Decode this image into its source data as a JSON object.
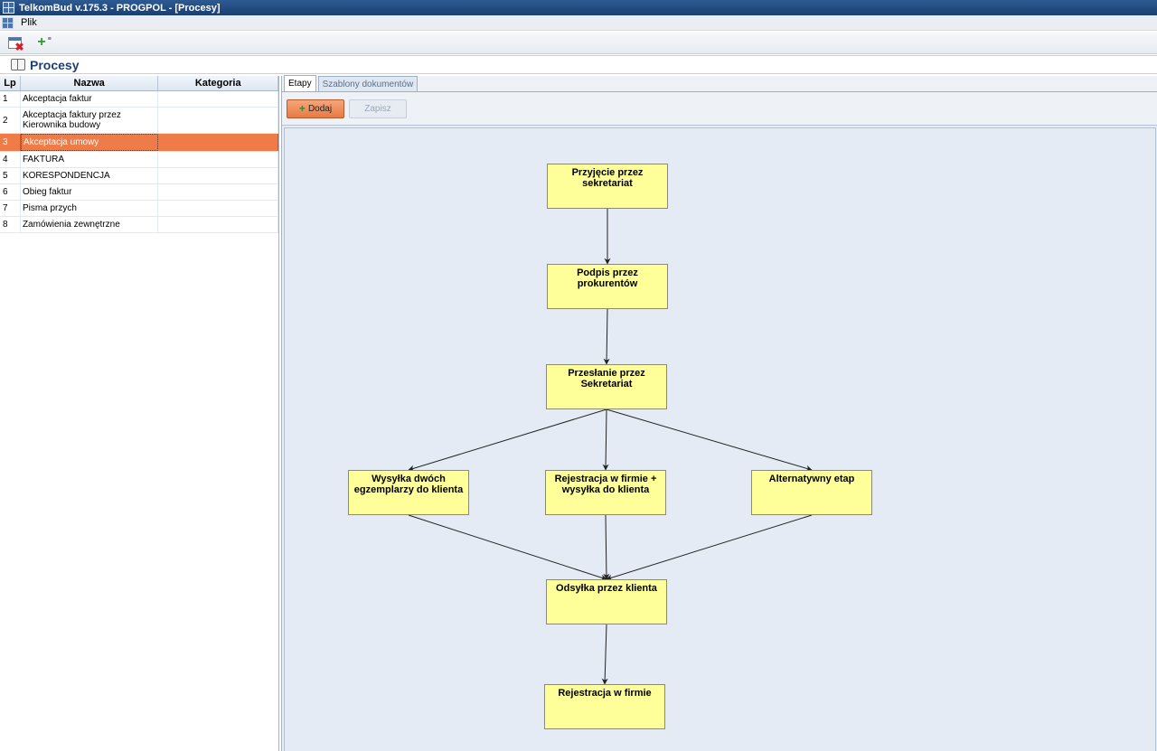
{
  "window": {
    "title": "TelkomBud v.175.3 - PROGPOL - [Procesy]"
  },
  "menu": {
    "items": [
      "Plik"
    ]
  },
  "toolbar": {
    "buttons": [
      "close-window",
      "add-process"
    ]
  },
  "header": {
    "title": "Procesy"
  },
  "grid": {
    "columns": {
      "lp": "Lp",
      "name": "Nazwa",
      "category": "Kategoria"
    },
    "rows": [
      {
        "lp": "1",
        "name": "Akceptacja faktur",
        "category": ""
      },
      {
        "lp": "2",
        "name": "Akceptacja faktury przez Kierownika budowy",
        "category": ""
      },
      {
        "lp": "3",
        "name": "Akceptacja umowy",
        "category": ""
      },
      {
        "lp": "4",
        "name": "FAKTURA",
        "category": ""
      },
      {
        "lp": "5",
        "name": "KORESPONDENCJA",
        "category": ""
      },
      {
        "lp": "6",
        "name": "Obieg faktur",
        "category": ""
      },
      {
        "lp": "7",
        "name": "Pisma przych",
        "category": ""
      },
      {
        "lp": "8",
        "name": "Zamówienia zewnętrzne",
        "category": ""
      }
    ],
    "selected_index": 2
  },
  "tabs": [
    {
      "label": "Etapy",
      "active": true
    },
    {
      "label": "Szablony dokumentów",
      "active": false
    }
  ],
  "actions": {
    "add_label": "Dodaj",
    "save_label": "Zapisz",
    "save_enabled": false
  },
  "diagram": {
    "stage_color": "#ffff99",
    "stages": [
      {
        "id": "s1",
        "label": "Przyjęcie przez sekretariat"
      },
      {
        "id": "s2",
        "label": "Podpis przez prokurentów"
      },
      {
        "id": "s3",
        "label": "Przesłanie przez Sekretariat"
      },
      {
        "id": "s4",
        "label": "Wysyłka dwóch egzemplarzy do klienta"
      },
      {
        "id": "s5",
        "label": "Rejestracja w firmie + wysyłka do klienta"
      },
      {
        "id": "s6",
        "label": "Alternatywny etap"
      },
      {
        "id": "s7",
        "label": "Odsyłka przez klienta"
      },
      {
        "id": "s8",
        "label": "Rejestracja w firmie"
      }
    ],
    "edges": [
      [
        "s1",
        "s2"
      ],
      [
        "s2",
        "s3"
      ],
      [
        "s3",
        "s4"
      ],
      [
        "s3",
        "s5"
      ],
      [
        "s3",
        "s6"
      ],
      [
        "s4",
        "s7"
      ],
      [
        "s5",
        "s7"
      ],
      [
        "s6",
        "s7"
      ],
      [
        "s7",
        "s8"
      ]
    ]
  },
  "colors": {
    "selection": "#ee7b48",
    "title_bar": "#1a3f72",
    "accent": "#1d3f73"
  }
}
